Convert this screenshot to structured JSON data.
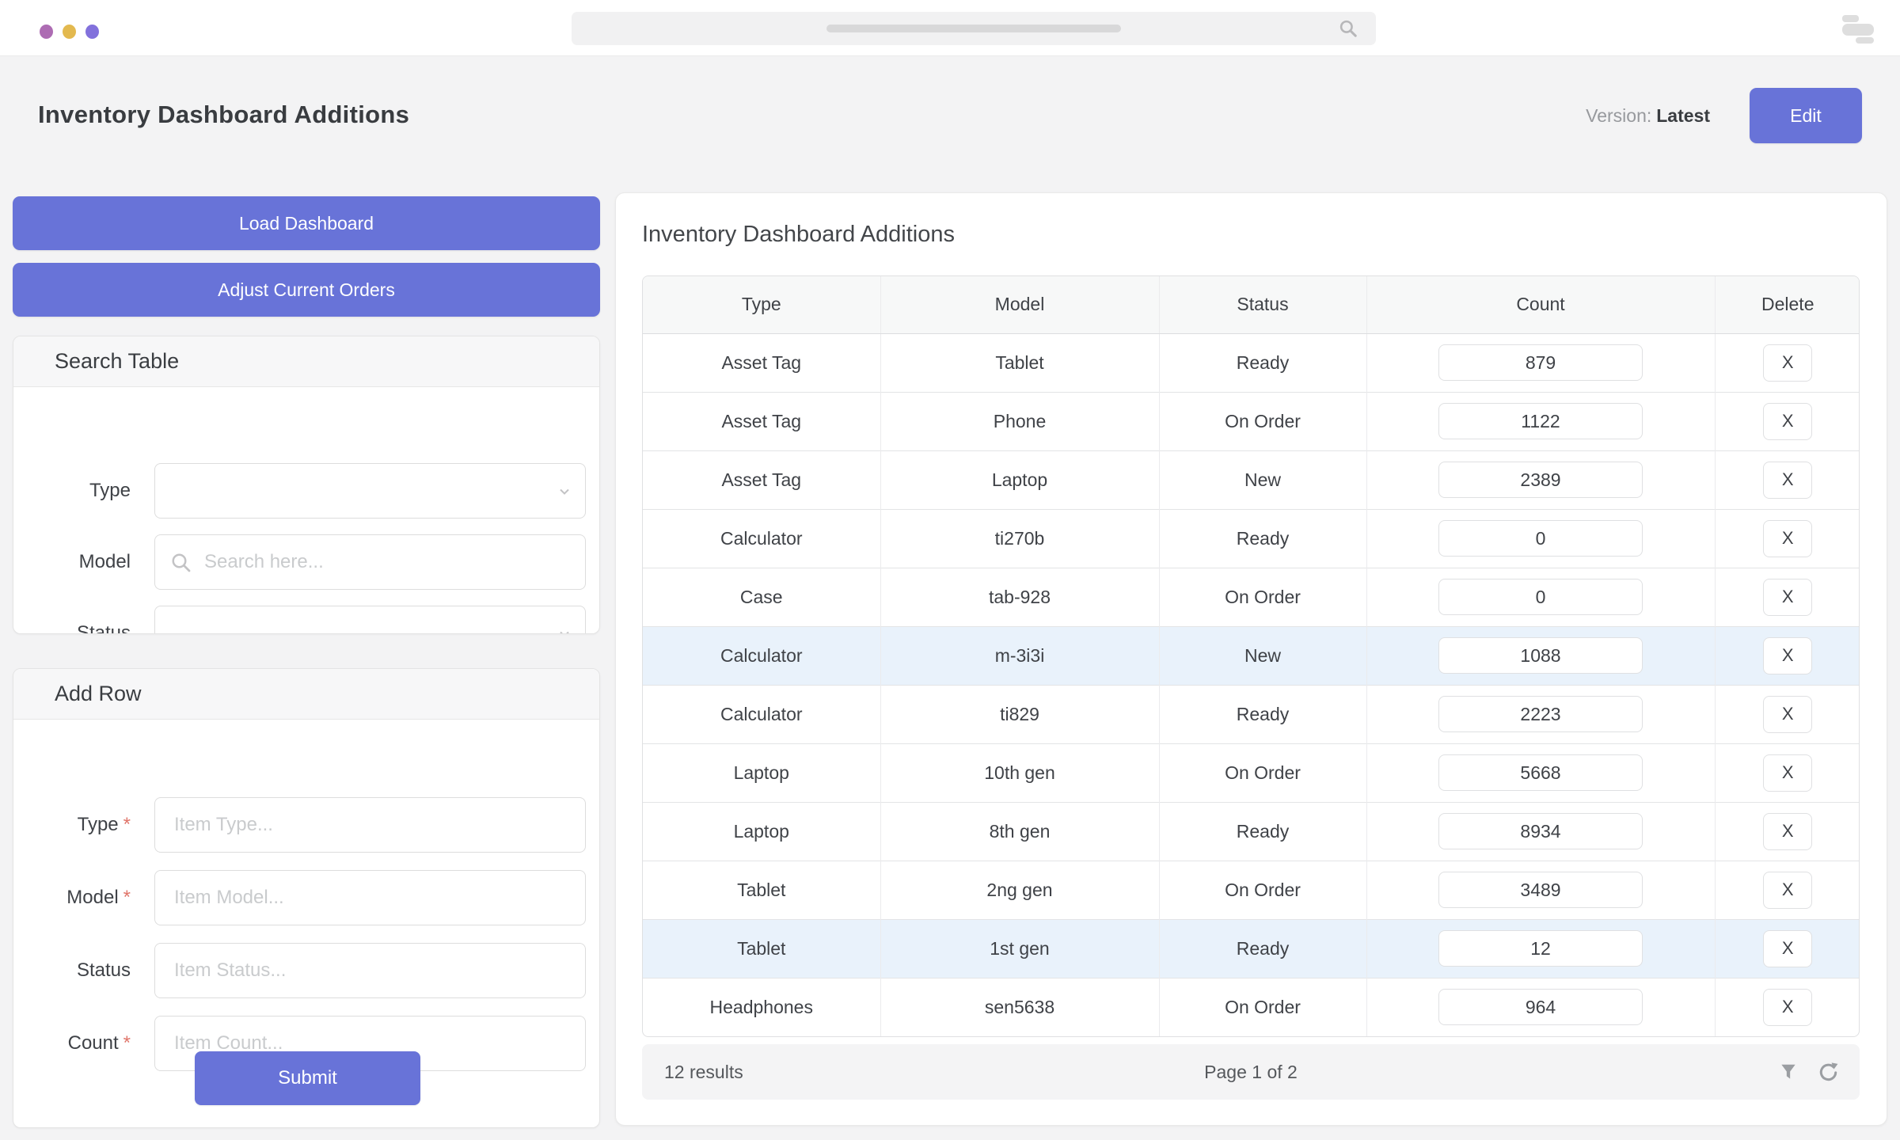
{
  "window": {
    "dot_colors": {
      "dot1": "#ad6cb3",
      "dot2": "#e3b94f",
      "dot3": "#8271dc"
    }
  },
  "header": {
    "title": "Inventory Dashboard Additions",
    "version_label": "Version:",
    "version_value": "Latest",
    "edit_button": "Edit"
  },
  "sidebar": {
    "load_button": "Load Dashboard",
    "adjust_button": "Adjust Current Orders",
    "search_card": {
      "title": "Search Table",
      "type_label": "Type",
      "model_label": "Model",
      "model_placeholder": "Search here...",
      "status_label": "Status"
    },
    "add_card": {
      "title": "Add Row",
      "type_label": "Type",
      "model_label": "Model",
      "status_label": "Status",
      "count_label": "Count",
      "required_mark": "*",
      "type_placeholder": "Item Type...",
      "model_placeholder": "Item Model...",
      "status_placeholder": "Item Status...",
      "count_placeholder": "Item Count...",
      "submit_button": "Submit"
    }
  },
  "table_panel": {
    "title": "Inventory Dashboard Additions",
    "columns": {
      "type": "Type",
      "model": "Model",
      "status": "Status",
      "count": "Count",
      "delete": "Delete"
    },
    "delete_label": "X",
    "rows": [
      {
        "type": "Asset Tag",
        "model": "Tablet",
        "status": "Ready",
        "count": "879",
        "highlighted": false
      },
      {
        "type": "Asset Tag",
        "model": "Phone",
        "status": "On Order",
        "count": "1122",
        "highlighted": false
      },
      {
        "type": "Asset Tag",
        "model": "Laptop",
        "status": "New",
        "count": "2389",
        "highlighted": false
      },
      {
        "type": "Calculator",
        "model": "ti270b",
        "status": "Ready",
        "count": "0",
        "highlighted": false
      },
      {
        "type": "Case",
        "model": "tab-928",
        "status": "On Order",
        "count": "0",
        "highlighted": false
      },
      {
        "type": "Calculator",
        "model": "m-3i3i",
        "status": "New",
        "count": "1088",
        "highlighted": true
      },
      {
        "type": "Calculator",
        "model": "ti829",
        "status": "Ready",
        "count": "2223",
        "highlighted": false
      },
      {
        "type": "Laptop",
        "model": "10th gen",
        "status": "On Order",
        "count": "5668",
        "highlighted": false
      },
      {
        "type": "Laptop",
        "model": "8th gen",
        "status": "Ready",
        "count": "8934",
        "highlighted": false
      },
      {
        "type": "Tablet",
        "model": "2ng gen",
        "status": "On Order",
        "count": "3489",
        "highlighted": false
      },
      {
        "type": "Tablet",
        "model": "1st gen",
        "status": "Ready",
        "count": "12",
        "highlighted": true
      },
      {
        "type": "Headphones",
        "model": "sen5638",
        "status": "On Order",
        "count": "964",
        "highlighted": false
      }
    ],
    "footer": {
      "results_text": "12 results",
      "page_text": "Page 1 of 2"
    }
  },
  "colors": {
    "accent": "#6873d8",
    "highlight_row": "#e9f2fb",
    "page_background": "#f3f3f4"
  }
}
